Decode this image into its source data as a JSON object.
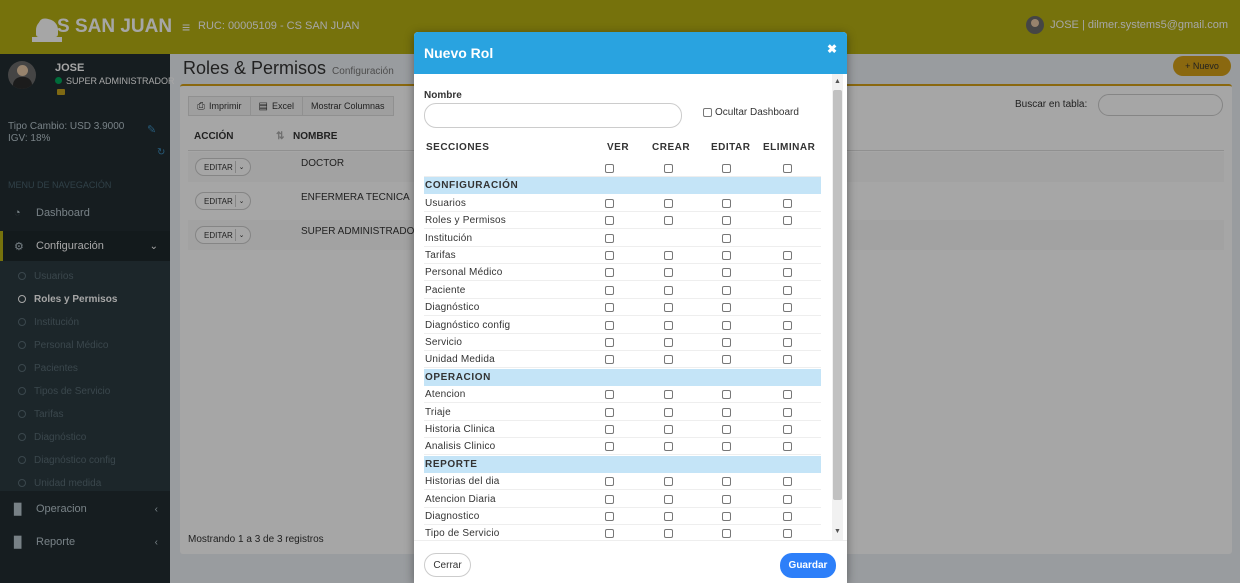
{
  "brand": {
    "name": "C.S SAN JUAN",
    "logo_color": "#ffffff",
    "accent": "#b5b013"
  },
  "navbar": {
    "toggle_icon": "hamburger-icon",
    "ruc": "RUC: 00005109 - CS SAN JUAN",
    "user": "JOSE | dilmer.systems5@gmail.com"
  },
  "sidebar": {
    "user": {
      "name": "JOSE",
      "role": "SUPER ADMINISTRADOR"
    },
    "tipo_cambio": "Tipo Cambio: USD 3.9000",
    "igv": "IGV: 18%",
    "menu_header": "MENU DE NAVEGACIÓN",
    "items": [
      {
        "label": "Dashboard",
        "icon": "dashboard-icon"
      },
      {
        "label": "Configuración",
        "icon": "gears-icon"
      },
      {
        "label": "Operacion",
        "icon": "book-icon"
      },
      {
        "label": "Reporte",
        "icon": "book-icon"
      }
    ],
    "submenu": [
      "Usuarios",
      "Roles y Permisos",
      "Institución",
      "Personal Médico",
      "Pacientes",
      "Tipos de Servicio",
      "Tarifas",
      "Diagnóstico",
      "Diagnóstico config",
      "Unidad medida"
    ]
  },
  "content": {
    "title": "Roles & Permisos",
    "subtitle": "Configuración",
    "nuevo_button": "+ Nuevo",
    "toolbar": {
      "print": "Imprimir",
      "excel": "Excel",
      "columns": "Mostrar Columnas"
    },
    "search_label": "Buscar en tabla:",
    "columns": [
      "ACCIÓN",
      "NOMBRE"
    ],
    "edit_label": "EDITAR",
    "rows": [
      "DOCTOR",
      "ENFERMERA TECNICA",
      "SUPER ADMINISTRADOR"
    ],
    "showing": "Mostrando 1 a 3 de 3 registros"
  },
  "modal": {
    "title": "Nuevo Rol",
    "nombre_label": "Nombre",
    "nombre_value": "",
    "ocultar_label": "Ocultar Dashboard",
    "headers": {
      "secciones": "SECCIONES",
      "ver": "VER",
      "crear": "CREAR",
      "editar": "EDITAR",
      "eliminar": "ELIMINAR"
    },
    "rows": [
      {
        "label": "",
        "type": "item",
        "boxes": [
          true,
          true,
          true,
          true
        ]
      },
      {
        "label": "CONFIGURACIÓN",
        "type": "section"
      },
      {
        "label": "Usuarios",
        "type": "item",
        "boxes": [
          true,
          true,
          true,
          true
        ]
      },
      {
        "label": "Roles y Permisos",
        "type": "item",
        "boxes": [
          true,
          true,
          true,
          true
        ]
      },
      {
        "label": "Institución",
        "type": "item",
        "boxes": [
          true,
          false,
          true,
          false
        ]
      },
      {
        "label": "Tarifas",
        "type": "item",
        "boxes": [
          true,
          true,
          true,
          true
        ]
      },
      {
        "label": "Personal Médico",
        "type": "item",
        "boxes": [
          true,
          true,
          true,
          true
        ]
      },
      {
        "label": "Paciente",
        "type": "item",
        "boxes": [
          true,
          true,
          true,
          true
        ]
      },
      {
        "label": "Diagnóstico",
        "type": "item",
        "boxes": [
          true,
          true,
          true,
          true
        ]
      },
      {
        "label": "Diagnóstico config",
        "type": "item",
        "boxes": [
          true,
          true,
          true,
          true
        ]
      },
      {
        "label": "Servicio",
        "type": "item",
        "boxes": [
          true,
          true,
          true,
          true
        ]
      },
      {
        "label": "Unidad Medida",
        "type": "item",
        "boxes": [
          true,
          true,
          true,
          true
        ]
      },
      {
        "label": "OPERACION",
        "type": "section"
      },
      {
        "label": "Atencion",
        "type": "item",
        "boxes": [
          true,
          true,
          true,
          true
        ]
      },
      {
        "label": "Triaje",
        "type": "item",
        "boxes": [
          true,
          true,
          true,
          true
        ]
      },
      {
        "label": "Historia Clinica",
        "type": "item",
        "boxes": [
          true,
          true,
          true,
          true
        ]
      },
      {
        "label": "Analisis Clinico",
        "type": "item",
        "boxes": [
          true,
          true,
          true,
          true
        ]
      },
      {
        "label": "REPORTE",
        "type": "section"
      },
      {
        "label": "Historias del dia",
        "type": "item",
        "boxes": [
          true,
          true,
          true,
          true
        ]
      },
      {
        "label": "Atencion Diaria",
        "type": "item",
        "boxes": [
          true,
          true,
          true,
          true
        ]
      },
      {
        "label": "Diagnostico",
        "type": "item",
        "boxes": [
          true,
          true,
          true,
          true
        ]
      },
      {
        "label": "Tipo de Servicio",
        "type": "item",
        "boxes": [
          true,
          true,
          true,
          true
        ]
      }
    ],
    "close_button": "Cerrar",
    "save_button": "Guardar"
  }
}
